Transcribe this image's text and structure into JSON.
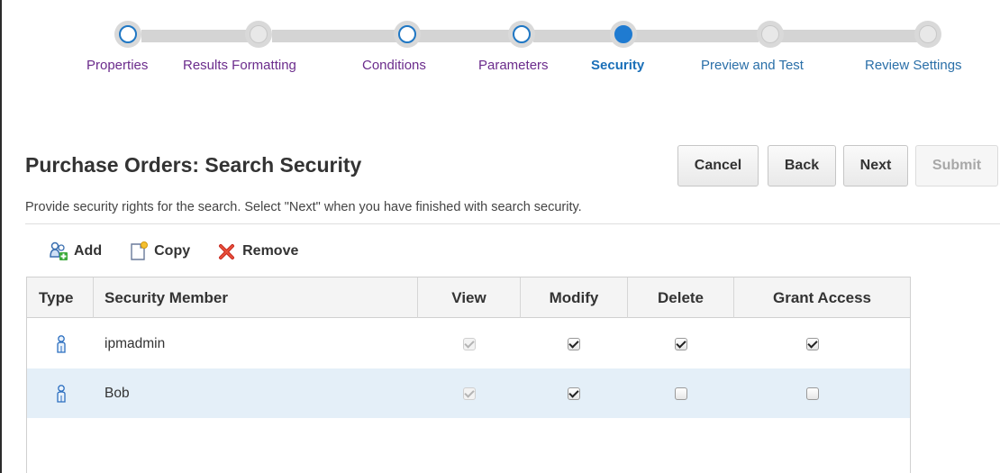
{
  "train": {
    "steps": [
      {
        "label": "Properties",
        "state": "visited"
      },
      {
        "label": "Results Formatting",
        "state": "unvisited"
      },
      {
        "label": "Conditions",
        "state": "visited"
      },
      {
        "label": "Parameters",
        "state": "visited"
      },
      {
        "label": "Security",
        "state": "current"
      },
      {
        "label": "Preview and Test",
        "state": "unvisited"
      },
      {
        "label": "Review Settings",
        "state": "unvisited"
      }
    ]
  },
  "header": {
    "title": "Purchase Orders: Search Security",
    "instructions": "Provide security rights for the search. Select \"Next\" when you have finished with search security.",
    "buttons": {
      "cancel": "Cancel",
      "back": "Back",
      "next": "Next",
      "submit": "Submit"
    }
  },
  "toolbar": {
    "add": "Add",
    "copy": "Copy",
    "remove": "Remove"
  },
  "table": {
    "columns": {
      "type": "Type",
      "member": "Security Member",
      "view": "View",
      "modify": "Modify",
      "delete": "Delete",
      "grant": "Grant Access"
    },
    "rows": [
      {
        "member": "ipmadmin",
        "view": true,
        "modify": true,
        "delete": true,
        "grant": true
      },
      {
        "member": "Bob",
        "view": true,
        "modify": true,
        "delete": false,
        "grant": false
      }
    ]
  },
  "colors": {
    "accent": "#1f7bd1",
    "visited_label": "#6b2c8c",
    "selected_row": "#e4eff8"
  },
  "icons": {
    "type_user": "user-icon",
    "add": "add-user-icon",
    "copy": "copy-icon",
    "remove": "remove-x-icon"
  }
}
